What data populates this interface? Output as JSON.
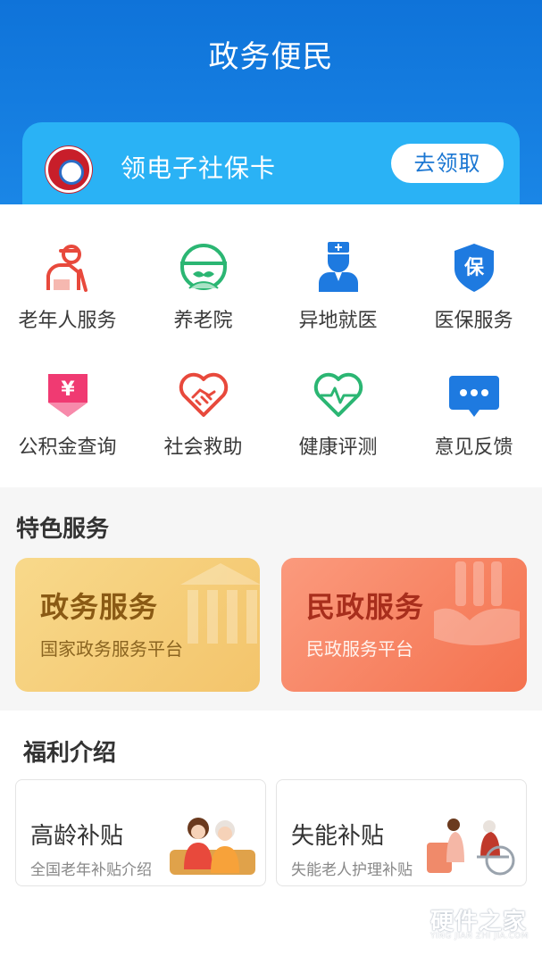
{
  "header": {
    "title": "政务便民"
  },
  "banner": {
    "text": "领电子社保卡",
    "button": "去领取",
    "logo": "social-security-card-logo"
  },
  "services": [
    {
      "label": "老年人服务",
      "icon": "elderly-person-icon",
      "color": "#e8493c"
    },
    {
      "label": "养老院",
      "icon": "nursing-home-icon",
      "color": "#2bb673"
    },
    {
      "label": "异地就医",
      "icon": "doctor-icon",
      "color": "#1e7ae0"
    },
    {
      "label": "医保服务",
      "icon": "medical-insurance-shield-icon",
      "color": "#1e7ae0"
    },
    {
      "label": "公积金查询",
      "icon": "yuan-fund-icon",
      "color": "#f03a72"
    },
    {
      "label": "社会救助",
      "icon": "heart-handshake-icon",
      "color": "#e8493c"
    },
    {
      "label": "健康评测",
      "icon": "heart-pulse-icon",
      "color": "#2bb673"
    },
    {
      "label": "意见反馈",
      "icon": "chat-bubble-icon",
      "color": "#1e7ae0"
    }
  ],
  "insurance_icon_text": "保",
  "fund_icon_text": "¥",
  "featured": {
    "title": "特色服务",
    "cards": [
      {
        "title": "政务服务",
        "subtitle": "国家政务服务平台"
      },
      {
        "title": "民政服务",
        "subtitle": "民政服务平台"
      }
    ]
  },
  "welfare": {
    "title": "福利介绍",
    "cards": [
      {
        "title": "高龄补贴",
        "subtitle": "全国老年补贴介绍"
      },
      {
        "title": "失能补贴",
        "subtitle": "失能老人护理补贴"
      }
    ]
  },
  "watermark": {
    "text": "硬件之家",
    "sub": "YING JIAN ZHI JIA.COM"
  }
}
